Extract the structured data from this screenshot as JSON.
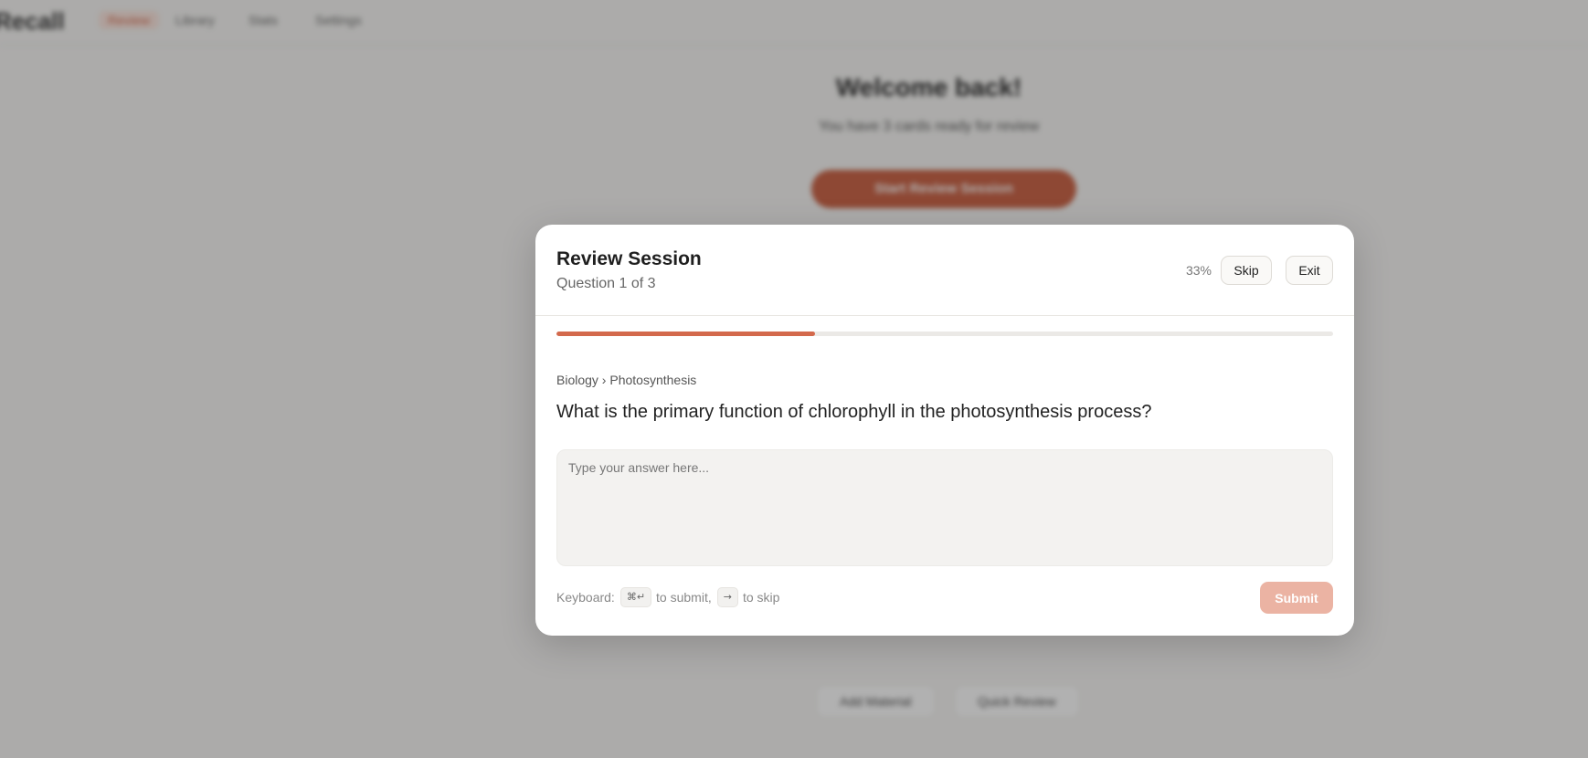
{
  "background": {
    "logo": "Recall",
    "nav": [
      "Review",
      "Library",
      "Stats",
      "Settings"
    ],
    "welcome": "Welcome back!",
    "subtitle": "You have 3 cards ready for review",
    "cta": "Start Review Session",
    "links": [
      "Add Material",
      "Quick Review"
    ]
  },
  "modal": {
    "title": "Review Session",
    "subtitle": "Question 1 of 3",
    "percent": "33%",
    "skip_label": "Skip",
    "exit_label": "Exit",
    "progress": 0.333,
    "breadcrumb": "Biology › Photosynthesis",
    "question": "What is the primary function of chlorophyll in the photosynthesis process?",
    "answer": {
      "value": "",
      "placeholder": "Type your answer here..."
    },
    "keyboard": {
      "prefix": "Keyboard:",
      "submit_key": "⌘↵",
      "submit_text": "to submit,",
      "skip_key": "→",
      "skip_text": "to skip"
    },
    "submit_label": "Submit"
  },
  "colors": {
    "accent": "#d3694c",
    "submit_disabled": "#ebb3a3"
  }
}
